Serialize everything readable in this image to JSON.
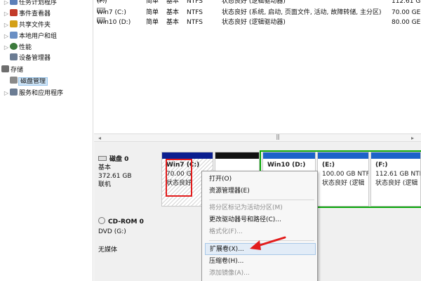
{
  "tree": {
    "items": [
      {
        "label": "任务计划程序",
        "icon_color": "#5b7fb8"
      },
      {
        "label": "事件查看器",
        "icon_color": "#c23b2a"
      },
      {
        "label": "共享文件夹",
        "icon_color": "#d4a017"
      },
      {
        "label": "本地用户和组",
        "icon_color": "#6a8fc4"
      },
      {
        "label": "性能",
        "icon_color": "#3c7a3c"
      },
      {
        "label": "设备管理器",
        "icon_color": "#6b7c93"
      },
      {
        "label": "存储",
        "icon_color": "#6e6e6e"
      },
      {
        "label": "磁盘管理",
        "icon_color": "#8a8a8a"
      },
      {
        "label": "服务和应用程序",
        "icon_color": "#6b7c93"
      }
    ]
  },
  "volumes": {
    "rows": [
      {
        "name": "(F:)",
        "layout": "简单",
        "type": "基本",
        "fs": "NTFS",
        "status": "状态良好 (逻辑驱动器)",
        "capacity": "112.61 G"
      },
      {
        "name": "Win7 (C:)",
        "layout": "简单",
        "type": "基本",
        "fs": "NTFS",
        "status": "状态良好 (系统, 启动, 页面文件, 活动, 故障转储, 主分区)",
        "capacity": "70.00 GE"
      },
      {
        "name": "Win10 (D:)",
        "layout": "简单",
        "type": "基本",
        "fs": "NTFS",
        "status": "状态良好 (逻辑驱动器)",
        "capacity": "80.00 GE"
      }
    ]
  },
  "scrollbar": {
    "left_arrow": "◂",
    "right_arrow": "▸"
  },
  "disks": {
    "disk0": {
      "name": "磁盘 0",
      "type": "基本",
      "size": "372.61 GB",
      "status": "联机"
    },
    "cdrom0": {
      "name": "CD-ROM 0",
      "drive": "DVD (G:)",
      "media": "无媒体"
    }
  },
  "partitions": [
    {
      "name": "Win7  (C:)",
      "size": "70.00 G",
      "status": "状态良好",
      "bar_color": "#0b1e8f"
    },
    {
      "name": "",
      "size": "",
      "status": "",
      "bar_color": "#111111"
    },
    {
      "name": "Win10  (D:)",
      "size": "",
      "status": "",
      "bar_color": "#1c63c9"
    },
    {
      "name": "(E:)",
      "size": "100.00 GB NTF",
      "status": "状态良好 (逻辑",
      "bar_color": "#1c63c9"
    },
    {
      "name": "(F:)",
      "size": "112.61 GB NTF",
      "status": "状态良好 (逻辑",
      "bar_color": "#1c63c9"
    }
  ],
  "colors": {
    "extended_frame": "#0aa80a",
    "highlight_box": "#e21c1c",
    "arrow": "#e21c1c"
  },
  "context_menu": {
    "items": [
      {
        "label": "打开(O)",
        "disabled": false
      },
      {
        "label": "资源管理器(E)",
        "disabled": false
      },
      {
        "label": "将分区标记为活动分区(M)",
        "disabled": true
      },
      {
        "label": "更改驱动器号和路径(C)...",
        "disabled": false
      },
      {
        "label": "格式化(F)...",
        "disabled": true
      },
      {
        "label": "扩展卷(X)...",
        "disabled": false,
        "highlighted": true
      },
      {
        "label": "压缩卷(H)...",
        "disabled": false
      },
      {
        "label": "添加镜像(A)...",
        "disabled": true
      }
    ]
  }
}
